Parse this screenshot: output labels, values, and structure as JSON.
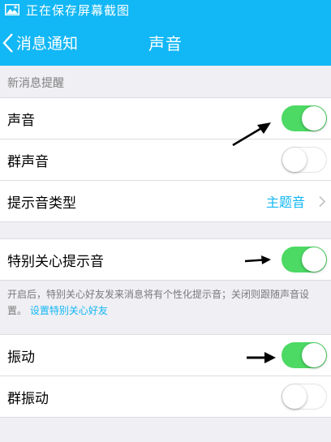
{
  "status_bar": {
    "text": "正在保存屏幕截图",
    "icon": "image-icon"
  },
  "nav": {
    "back_label": "消息通知",
    "title": "声音"
  },
  "section_header": "新消息提醒",
  "rows": {
    "sound": {
      "label": "声音",
      "toggle": "on"
    },
    "group_sound": {
      "label": "群声音",
      "toggle": "off"
    },
    "tone_type": {
      "label": "提示音类型",
      "value": "主题音"
    },
    "special_tone": {
      "label": "特别关心提示音",
      "toggle": "on"
    },
    "vibrate": {
      "label": "振动",
      "toggle": "on"
    },
    "group_vibrate": {
      "label": "群振动",
      "toggle": "off"
    }
  },
  "note": {
    "text": "开启后，特别关心好友发来消息将有个性化提示音；关闭则跟随声音设置。",
    "link": "设置特别关心好友"
  },
  "colors": {
    "header": "#12b7f5",
    "toggle_on": "#4cd964",
    "link": "#12b7f5",
    "background": "#efeff4"
  }
}
